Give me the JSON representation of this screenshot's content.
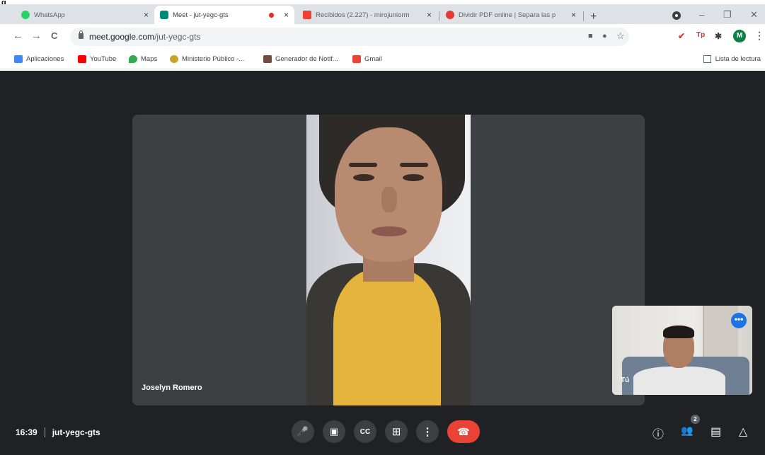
{
  "corner_mark": "g",
  "tabs": [
    {
      "title": "WhatsApp",
      "close": "×",
      "favicon_color": "#25d366"
    },
    {
      "title": "Meet - jut-yegc-gts",
      "close": "×",
      "favicon_color": "#00897b"
    },
    {
      "title": "Recibidos (2.227) - mirojuniorm",
      "close": "×",
      "favicon_color": "#ea4335"
    },
    {
      "title": "Dividir PDF online | Separa las p",
      "close": "×",
      "favicon_color": "#e53935"
    }
  ],
  "newtab": "+",
  "window_controls": {
    "minimize": "–",
    "restore": "❐",
    "close": "✕"
  },
  "nav": {
    "back": "←",
    "forward": "→",
    "reload": "C"
  },
  "address": {
    "host": "meet.google.com",
    "path": "/jut-yegc-gts"
  },
  "omni_icons": {
    "camera": "■",
    "mic": "●",
    "star": "☆"
  },
  "extensions": {
    "ext1": "✔",
    "ext2": "Tp",
    "puzzle": "✱",
    "profile": "M",
    "menu": "⋮"
  },
  "bookmarks": [
    {
      "label": "Aplicaciones",
      "color": "#4285f4"
    },
    {
      "label": "YouTube",
      "color": "#ff0000"
    },
    {
      "label": "Maps",
      "color": "#34a853"
    },
    {
      "label": "Ministerio Público -...",
      "color": "#c9a227"
    },
    {
      "label": "Generador de Notif...",
      "color": "#6d4c41"
    },
    {
      "label": "Gmail",
      "color": "#ea4335"
    }
  ],
  "reading_list": "Lista de lectura",
  "meet": {
    "main_participant": "Joselyn Romero",
    "self_label": "Tú",
    "self_more": "•••",
    "time": "16:39",
    "meeting_code": "jut-yegc-gts",
    "controls": {
      "mic": "🎤",
      "camera": "▣",
      "captions": "CC",
      "present": "⊞",
      "more": "⋮",
      "end": "☎"
    },
    "right_controls": {
      "info": "ⓘ",
      "people": "👥",
      "people_count": "2",
      "chat": "▤",
      "activities": "△"
    }
  }
}
